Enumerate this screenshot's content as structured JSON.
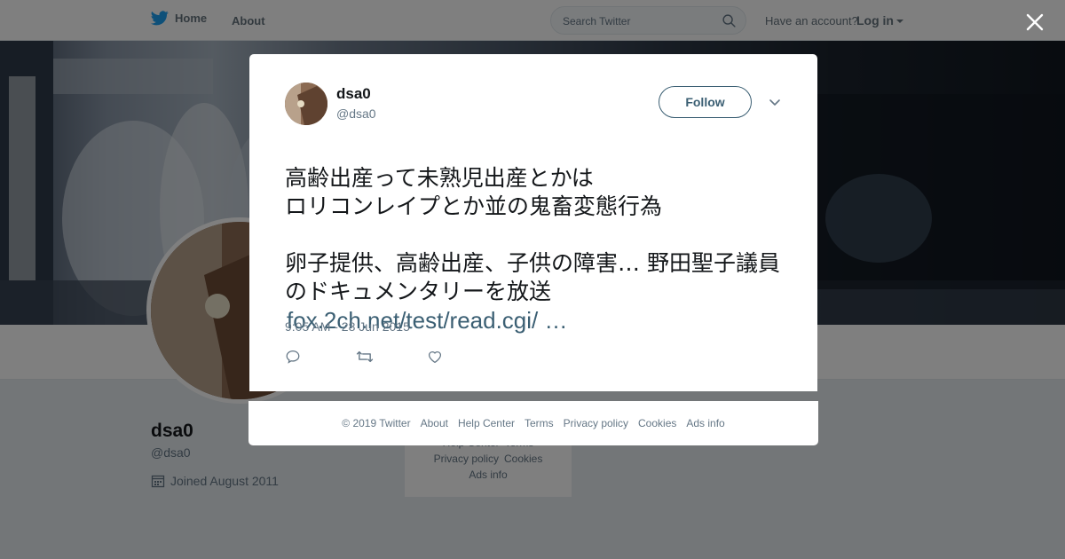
{
  "topbar": {
    "home_label": "Home",
    "about_label": "About",
    "search_placeholder": "Search Twitter",
    "have_account": "Have an account?",
    "login_label": "Log in"
  },
  "profile": {
    "name": "dsa0",
    "handle": "@dsa0",
    "joined": "Joined August 2011"
  },
  "side_footer": {
    "row1": [
      "Help Center",
      "Terms"
    ],
    "row2": [
      "Privacy policy",
      "Cookies"
    ],
    "row3": "Ads info"
  },
  "tweet": {
    "name": "dsa0",
    "handle": "@dsa0",
    "follow_label": "Follow",
    "text": "高齢出産って未熟児出産とかは\nロリコンレイプとか並の鬼畜変態行為\n\n卵子提供、高齢出産、子供の障害… 野田聖子議員のドキュメンタリーを放送",
    "link": "fox.2ch.net/test/read.cgi/ …",
    "timestamp": "9:05 AM - 28 Jun 2015"
  },
  "footer": {
    "copyright": "© 2019 Twitter",
    "links": [
      "About",
      "Help Center",
      "Terms",
      "Privacy policy",
      "Cookies",
      "Ads info"
    ]
  },
  "colors": {
    "twitter_blue": "#1da1f2",
    "link_color": "#3b5f73",
    "muted_text": "#657786"
  },
  "icons": [
    "twitter-bird-icon",
    "search-icon",
    "close-icon",
    "chevron-down-icon",
    "reply-icon",
    "retweet-icon",
    "like-icon",
    "calendar-icon"
  ]
}
